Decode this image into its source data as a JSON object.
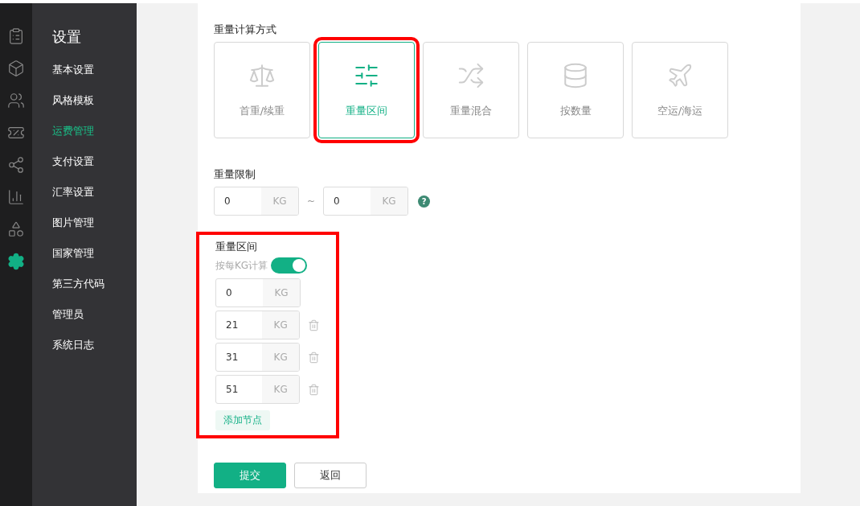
{
  "rail": [
    {
      "selected": false
    },
    {
      "selected": false
    },
    {
      "selected": false
    },
    {
      "selected": false
    },
    {
      "selected": false
    },
    {
      "selected": false
    },
    {
      "selected": false
    },
    {
      "selected": true
    }
  ],
  "sidebar": {
    "title": "设置",
    "items": [
      {
        "label": "基本设置",
        "selected": false
      },
      {
        "label": "风格模板",
        "selected": false
      },
      {
        "label": "运费管理",
        "selected": true
      },
      {
        "label": "支付设置",
        "selected": false
      },
      {
        "label": "汇率设置",
        "selected": false
      },
      {
        "label": "图片管理",
        "selected": false
      },
      {
        "label": "国家管理",
        "selected": false
      },
      {
        "label": "第三方代码",
        "selected": false
      },
      {
        "label": "管理员",
        "selected": false
      },
      {
        "label": "系统日志",
        "selected": false
      }
    ]
  },
  "method": {
    "label": "重量计算方式",
    "options": [
      {
        "label": "首重/续重",
        "selected": false,
        "highlighted": false
      },
      {
        "label": "重量区间",
        "selected": true,
        "highlighted": true
      },
      {
        "label": "重量混合",
        "selected": false,
        "highlighted": false
      },
      {
        "label": "按数量",
        "selected": false,
        "highlighted": false
      },
      {
        "label": "空运/海运",
        "selected": false,
        "highlighted": false
      }
    ]
  },
  "limit": {
    "label": "重量限制",
    "min": "0",
    "max": "0",
    "unit": "KG",
    "unit_2": "KG",
    "separator": "~",
    "help": "?"
  },
  "interval": {
    "label": "重量区间",
    "highlighted": true,
    "per_kg_label": "按每KG计算",
    "per_kg_on": true,
    "rows": [
      {
        "value": "0",
        "unit": "KG",
        "deletable": false
      },
      {
        "value": "21",
        "unit": "KG",
        "deletable": true
      },
      {
        "value": "31",
        "unit": "KG",
        "deletable": true
      },
      {
        "value": "51",
        "unit": "KG",
        "deletable": true
      }
    ],
    "add_button": "添加节点"
  },
  "buttons": {
    "submit": "提交",
    "back": "返回"
  }
}
